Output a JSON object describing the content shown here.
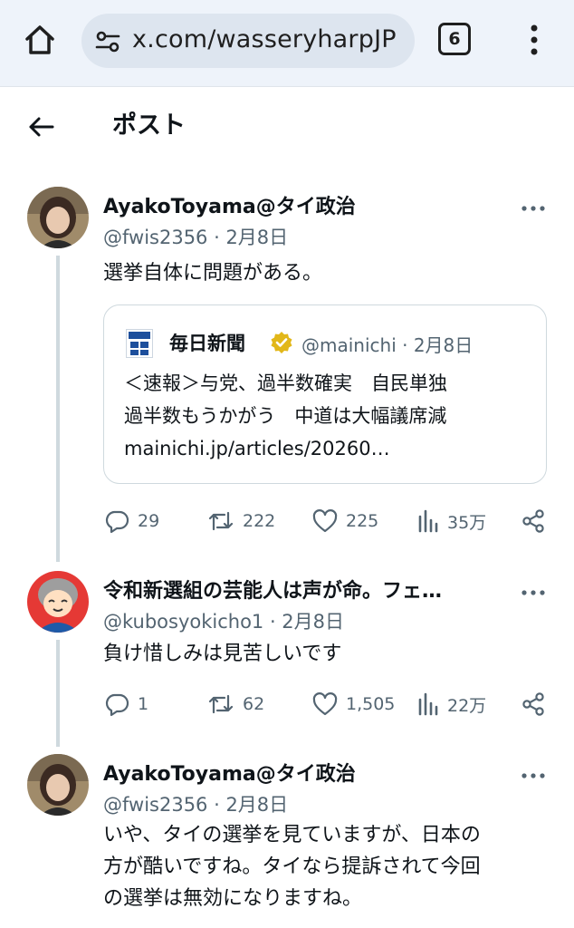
{
  "browser": {
    "url": "x.com/wasseryharpJP",
    "tab_count": "6"
  },
  "header": {
    "title": "ポスト"
  },
  "posts": [
    {
      "name": "AyakoToyama@タイ政治",
      "handle_date": "@fwis2356 · 2月8日",
      "text": "選挙自体に問題がある。",
      "quote": {
        "name": "毎日新聞",
        "handle_date": "@mainichi · 2月8日",
        "line1": "＜速報＞与党、過半数確実　自民単独",
        "line2": "過半数もうかがう　中道は大幅議席減",
        "link": "mainichi.jp/articles/20260…"
      },
      "replies": "29",
      "reposts": "222",
      "likes": "225",
      "views": "35万"
    },
    {
      "name": "令和新選組の芸能人は声が命。フェ…",
      "handle_date": "@kubosyokicho1 · 2月8日",
      "text": "負け惜しみは見苦しいです",
      "replies": "1",
      "reposts": "62",
      "likes": "1,505",
      "views": "22万"
    },
    {
      "name": "AyakoToyama@タイ政治",
      "handle_date": "@fwis2356 · 2月8日",
      "text_lines": [
        "いや、タイの選挙を見ていますが、日本の",
        "方が酷いですね。タイなら提訴されて今回",
        "の選挙は無効になりますね。"
      ]
    }
  ],
  "icons": {
    "home": "home-icon",
    "site_settings": "tune-icon",
    "tabs": "tabs-icon",
    "menu": "more-vert-icon",
    "back": "back-arrow-icon",
    "more": "more-horiz-icon",
    "reply": "reply-icon",
    "repost": "repost-icon",
    "like": "like-icon",
    "views": "views-icon",
    "share": "share-icon",
    "verified": "verified-badge-icon"
  },
  "colors": {
    "text_primary": "#0f1419",
    "text_secondary": "#536471",
    "verified_gold": "#e2b719",
    "chrome_bg": "#eef3fa"
  }
}
